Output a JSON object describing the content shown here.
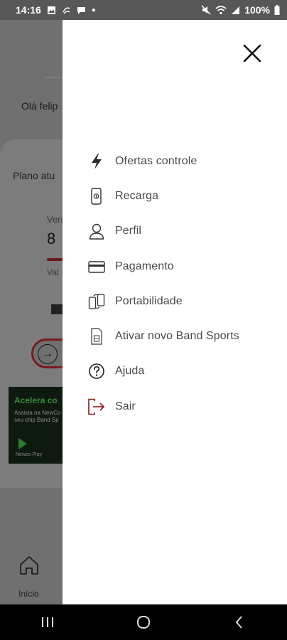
{
  "status_bar": {
    "time": "14:16",
    "battery": "100%"
  },
  "background_app": {
    "greeting": "Olá felip",
    "plan_label": "Plano atu",
    "vencimento_label": "Ven",
    "number": "8",
    "valor_label": "Val",
    "banner_title": "Acelera co",
    "banner_line1": "Assista na NewCo",
    "banner_line2": "seu chip Band Sp",
    "banner_brand": "Newco Play",
    "home_label": "Início"
  },
  "drawer": {
    "close_icon": "close-icon",
    "accent_color": "#8b1a1a",
    "items": [
      {
        "label": "Ofertas controle",
        "icon": "lightning-icon"
      },
      {
        "label": "Recarga",
        "icon": "phone-recharge-icon"
      },
      {
        "label": "Perfil",
        "icon": "user-icon"
      },
      {
        "label": "Pagamento",
        "icon": "credit-card-icon"
      },
      {
        "label": "Portabilidade",
        "icon": "portability-icon"
      },
      {
        "label": "Ativar novo Band Sports",
        "icon": "sim-card-icon"
      },
      {
        "label": "Ajuda",
        "icon": "help-icon"
      },
      {
        "label": "Sair",
        "icon": "logout-icon"
      }
    ]
  }
}
